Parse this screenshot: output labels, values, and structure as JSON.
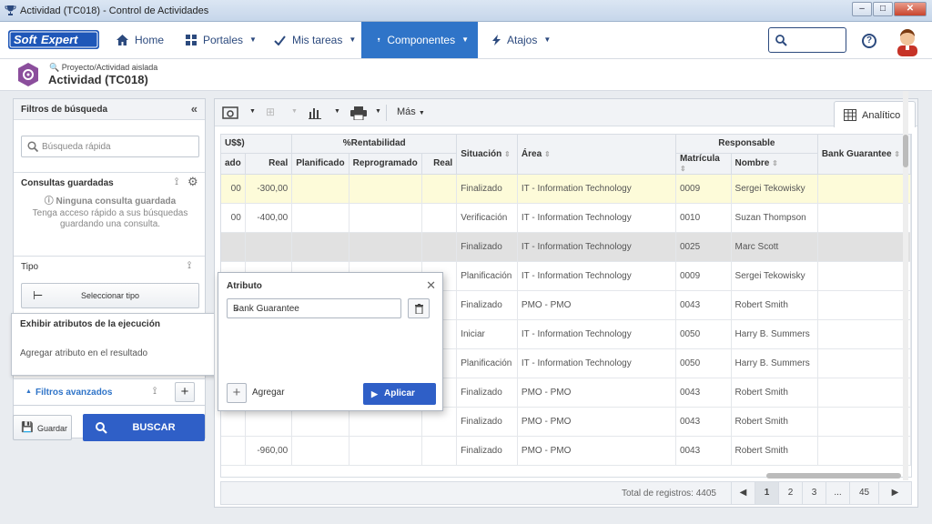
{
  "window": {
    "title": "Actividad (TC018) - Control de Actividades"
  },
  "brand": {
    "logo": "SoftExpert"
  },
  "nav": {
    "home": "Home",
    "portales": "Portales",
    "tareas": "Mis tareas",
    "componentes": "Componentes",
    "atajos": "Atajos"
  },
  "page": {
    "path": "Proyecto/Actividad aislada",
    "title": "Actividad (TC018)"
  },
  "left": {
    "header": "Filtros de búsqueda",
    "quick_search": "Búsqueda rápida",
    "saved_title": "Consultas guardadas",
    "saved_empty": "Ninguna consulta guardada",
    "saved_hint": "Tenga acceso rápido a sus búsquedas guardando una consulta.",
    "tipo": "Tipo",
    "select_tipo": "Seleccionar tipo",
    "advanced": "Filtros avanzados",
    "save": "Guardar",
    "search": "BUSCAR"
  },
  "popout": {
    "title": "Exhibir atributos de la ejecución",
    "sub": "Agregar atributo en el resultado"
  },
  "toolbar": {
    "more": "Más",
    "tab": "Analítico"
  },
  "grid": {
    "group_cost": "U$$)",
    "group_rent": "%Rentabilidad",
    "group_resp": "Responsable",
    "h_ado": "ado",
    "h_real": "Real",
    "h_plan": "Planificado",
    "h_repro": "Reprogramado",
    "h_real2": "Real",
    "h_sit": "Situación",
    "h_area": "Área",
    "h_mat": "Matrícula",
    "h_nom": "Nombre",
    "h_bg": "Bank Guarantee",
    "rows": [
      {
        "c1": "00",
        "c2": "-300,00",
        "sit": "Finalizado",
        "area": "IT - Information Technology",
        "mat": "0009",
        "nom": "Sergei Tekowisky"
      },
      {
        "c1": "00",
        "c2": "-400,00",
        "sit": "Verificación",
        "area": "IT - Information Technology",
        "mat": "0010",
        "nom": "Suzan Thompson"
      },
      {
        "c1": "",
        "c2": "",
        "sit": "Finalizado",
        "area": "IT - Information Technology",
        "mat": "0025",
        "nom": "Marc Scott"
      },
      {
        "c1": "",
        "c2": "",
        "sit": "Planificación",
        "area": "IT - Information Technology",
        "mat": "0009",
        "nom": "Sergei Tekowisky"
      },
      {
        "c1": "",
        "c2": "",
        "sit": "Finalizado",
        "area": "PMO - PMO",
        "mat": "0043",
        "nom": "Robert Smith"
      },
      {
        "c1": "",
        "c2": "",
        "sit": "Iniciar",
        "area": "IT - Information Technology",
        "mat": "0050",
        "nom": "Harry B. Summers"
      },
      {
        "c1": "",
        "c2": "",
        "sit": "Planificación",
        "area": "IT - Information Technology",
        "mat": "0050",
        "nom": "Harry B. Summers"
      },
      {
        "c1": "",
        "c2": "",
        "sit": "Finalizado",
        "area": "PMO - PMO",
        "mat": "0043",
        "nom": "Robert Smith"
      },
      {
        "c1": "",
        "c2": "",
        "sit": "Finalizado",
        "area": "PMO - PMO",
        "mat": "0043",
        "nom": "Robert Smith"
      },
      {
        "c1": "",
        "c2": "-960,00",
        "sit": "Finalizado",
        "area": "PMO - PMO",
        "mat": "0043",
        "nom": "Robert Smith"
      }
    ]
  },
  "footer": {
    "total": "Total de registros: 4405",
    "p1": "1",
    "p2": "2",
    "p3": "3",
    "dots": "...",
    "p45": "45"
  },
  "dialog": {
    "title": "Atributo",
    "value": "Bank Guarantee",
    "add": "Agregar",
    "apply": "Aplicar"
  },
  "colors": {
    "primary": "#2f74c8",
    "button": "#2f5fc7",
    "highlight_row": "#fdfbd9"
  }
}
